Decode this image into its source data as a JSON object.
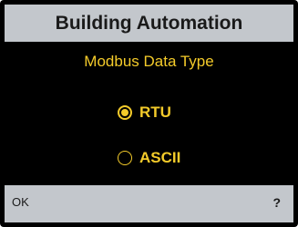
{
  "header": {
    "title": "Building Automation"
  },
  "screen": {
    "subtitle": "Modbus Data Type",
    "options": [
      {
        "label": "RTU",
        "selected": true
      },
      {
        "label": "ASCII",
        "selected": false
      }
    ]
  },
  "footer": {
    "left_softkey": "OK",
    "right_softkey": "?"
  },
  "colors": {
    "accent": "#f4cb2a",
    "panel": "#c3c7cc",
    "background": "#000000",
    "text_dark": "#1a1a1a"
  },
  "icons": {
    "selected_radio": "radio-selected-icon",
    "unselected_radio": "radio-unselected-icon"
  }
}
